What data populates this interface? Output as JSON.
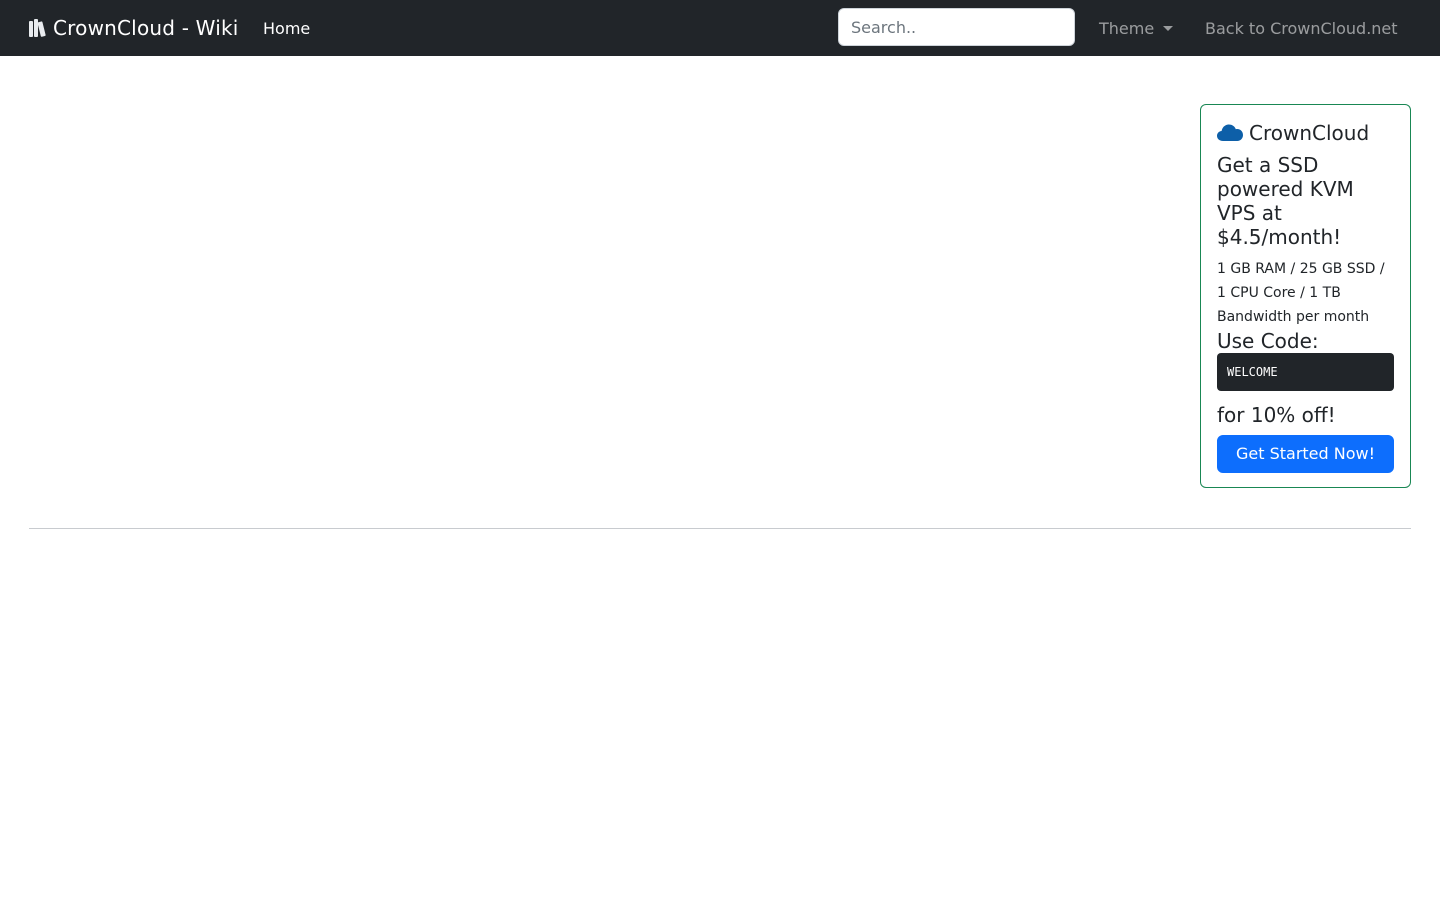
{
  "navbar": {
    "brand": "CrownCloud - Wiki",
    "brand_icon": "books-icon",
    "home_label": "Home",
    "search_placeholder": "Search..",
    "theme_label": "Theme",
    "back_label": "Back to CrownCloud.net"
  },
  "ad": {
    "brand": "CrownCloud",
    "brand_icon": "cloud-icon",
    "headline": "Get a SSD powered KVM VPS at $4.5/month!",
    "specs": "1 GB RAM / 25 GB SSD / 1 CPU Core / 1 TB Bandwidth per month",
    "use_code_label": "Use Code:",
    "code": "WELCOME",
    "discount": "for 10% off!",
    "cta_label": "Get Started Now!"
  },
  "colors": {
    "navbar_bg": "#212529",
    "card_border": "#198754",
    "cloud_icon": "#0d5fa8",
    "button_bg": "#0d6efd"
  }
}
